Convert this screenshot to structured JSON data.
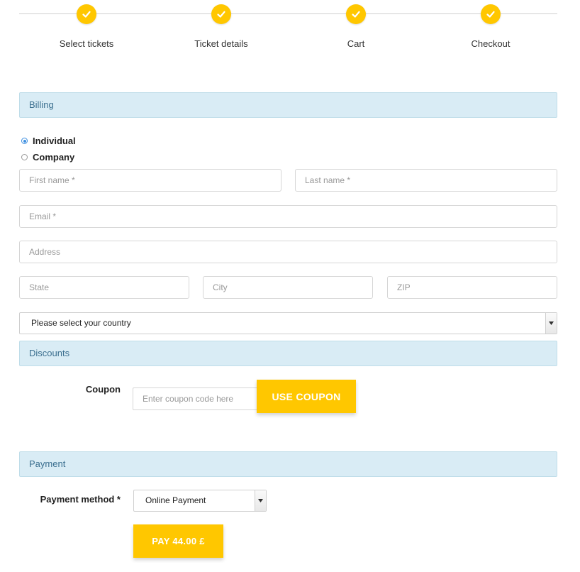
{
  "stepper": {
    "steps": [
      {
        "label": "Select tickets",
        "icon": "check-icon",
        "completed": true
      },
      {
        "label": "Ticket details",
        "icon": "check-icon",
        "completed": true
      },
      {
        "label": "Cart",
        "icon": "check-icon",
        "completed": true
      },
      {
        "label": "Checkout",
        "icon": "check-icon",
        "completed": true
      }
    ]
  },
  "billing": {
    "title": "Billing",
    "type_options": [
      {
        "label": "Individual",
        "selected": true
      },
      {
        "label": "Company",
        "selected": false
      }
    ],
    "first_name": {
      "placeholder": "First name *",
      "value": ""
    },
    "last_name": {
      "placeholder": "Last name *",
      "value": ""
    },
    "email": {
      "placeholder": "Email *",
      "value": ""
    },
    "address": {
      "placeholder": "Address",
      "value": ""
    },
    "state": {
      "placeholder": "State",
      "value": ""
    },
    "city": {
      "placeholder": "City",
      "value": ""
    },
    "zip": {
      "placeholder": "ZIP",
      "value": ""
    },
    "country": {
      "selected": "Please select your country"
    }
  },
  "discounts": {
    "title": "Discounts",
    "coupon_label": "Coupon",
    "coupon": {
      "placeholder": "Enter coupon code here",
      "value": ""
    },
    "use_coupon_label": "USE COUPON"
  },
  "payment": {
    "title": "Payment",
    "method_label": "Payment method *",
    "method_selected": "Online Payment",
    "pay_label": "PAY 44.00 £"
  },
  "colors": {
    "accent": "#ffc700",
    "section_bg": "#d9ecf5",
    "section_text": "#3b6f8f",
    "radio_selected": "#3d8fe0"
  }
}
